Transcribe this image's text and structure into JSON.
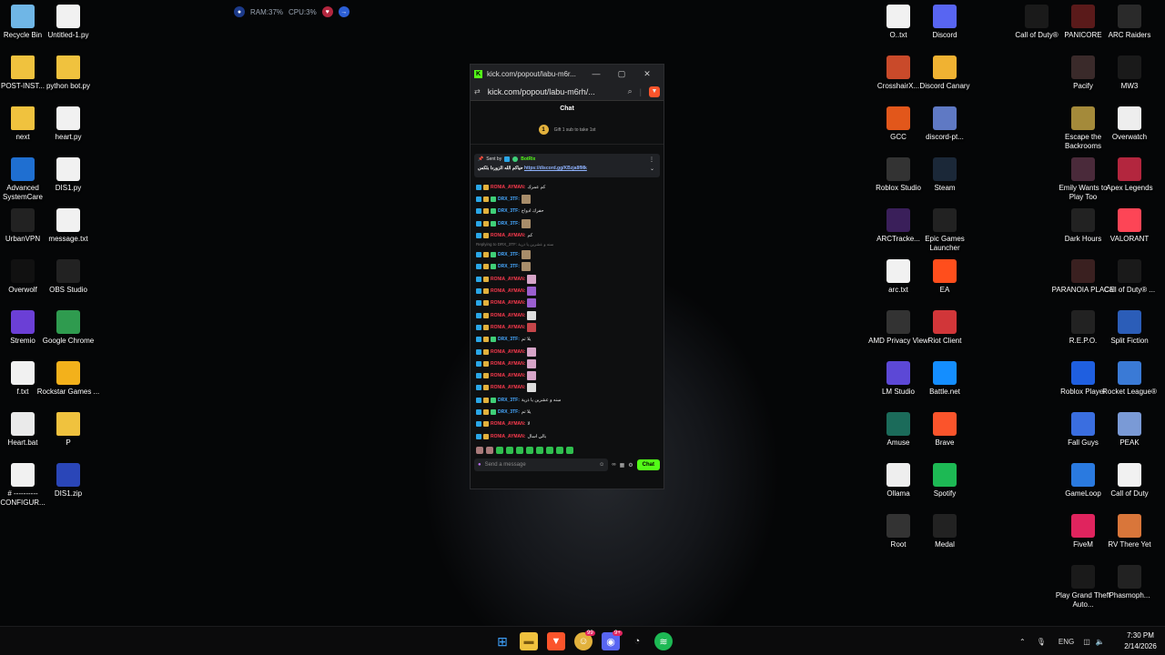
{
  "overlay": {
    "ram": "RAM:37%",
    "cpu": "CPU:3%"
  },
  "desktop": {
    "left": [
      {
        "label": "Recycle Bin",
        "icon": "recycle-bin-icon"
      },
      {
        "label": "Untitled-1.py",
        "icon": "python-file-icon"
      },
      {
        "label": "POST-INST...",
        "icon": "folder-icon"
      },
      {
        "label": "python bot.py",
        "icon": "folder-icon"
      },
      {
        "label": "next",
        "icon": "folder-icon"
      },
      {
        "label": "heart.py",
        "icon": "python-file-icon"
      },
      {
        "label": "Advanced SystemCare",
        "icon": "advanced-systemcare-icon"
      },
      {
        "label": "DIS1.py",
        "icon": "python-file-icon"
      },
      {
        "label": "UrbanVPN",
        "icon": "urbanvpn-icon"
      },
      {
        "label": "message.txt",
        "icon": "text-file-icon"
      },
      {
        "label": "Overwolf",
        "icon": "overwolf-icon"
      },
      {
        "label": "OBS Studio",
        "icon": "obs-icon"
      },
      {
        "label": "Stremio",
        "icon": "stremio-icon"
      },
      {
        "label": "Google Chrome",
        "icon": "chrome-icon"
      },
      {
        "label": "f.txt",
        "icon": "text-file-icon"
      },
      {
        "label": "Rockstar Games ...",
        "icon": "rockstar-icon"
      },
      {
        "label": "Heart.bat",
        "icon": "batch-file-icon"
      },
      {
        "label": "P",
        "icon": "folder-icon"
      },
      {
        "label": "# ---------- CONFIGUR...",
        "icon": "python-file-icon"
      },
      {
        "label": "DIS1.zip",
        "icon": "zip-file-icon"
      }
    ],
    "mid": [
      {
        "label": "O..txt",
        "icon": "text-file-icon"
      },
      {
        "label": "Discord",
        "icon": "discord-icon"
      },
      {
        "label": "CrosshairX...",
        "icon": "crosshairx-icon"
      },
      {
        "label": "Discord Canary",
        "icon": "discord-canary-icon"
      },
      {
        "label": "GCC",
        "icon": "gcc-icon"
      },
      {
        "label": "discord-pt...",
        "icon": "discord-ptb-icon"
      },
      {
        "label": "Roblox Studio",
        "icon": "roblox-studio-icon"
      },
      {
        "label": "Steam",
        "icon": "steam-icon"
      },
      {
        "label": "ARCTracke...",
        "icon": "arctracker-icon"
      },
      {
        "label": "Epic Games Launcher",
        "icon": "epic-games-icon"
      },
      {
        "label": "arc.txt",
        "icon": "text-file-icon"
      },
      {
        "label": "EA",
        "icon": "ea-icon"
      },
      {
        "label": "AMD Privacy View",
        "icon": "amd-icon"
      },
      {
        "label": "Riot Client",
        "icon": "riot-icon"
      },
      {
        "label": "LM Studio",
        "icon": "lm-studio-icon"
      },
      {
        "label": "Battle.net",
        "icon": "battlenet-icon"
      },
      {
        "label": "Amuse",
        "icon": "amuse-icon"
      },
      {
        "label": "Brave",
        "icon": "brave-icon"
      },
      {
        "label": "Ollama",
        "icon": "ollama-icon"
      },
      {
        "label": "Spotify",
        "icon": "spotify-icon"
      },
      {
        "label": "Root",
        "icon": "root-icon"
      },
      {
        "label": "Medal",
        "icon": "medal-icon"
      }
    ],
    "right": [
      {
        "label": "Call of Duty®",
        "icon": "cod-icon"
      },
      {
        "label": "PANICORE",
        "icon": "panicore-icon"
      },
      {
        "label": "ARC Raiders",
        "icon": "arc-raiders-icon"
      },
      {
        "label": "Pacify",
        "icon": "pacify-icon"
      },
      {
        "label": "MW3",
        "icon": "mw3-icon"
      },
      {
        "label": "Escape the Backrooms",
        "icon": "backrooms-icon"
      },
      {
        "label": "Overwatch",
        "icon": "overwatch-icon"
      },
      {
        "label": "Emily Wants to Play Too",
        "icon": "emily-icon"
      },
      {
        "label": "Apex Legends",
        "icon": "apex-icon"
      },
      {
        "label": "Dark Hours",
        "icon": "dark-hours-icon"
      },
      {
        "label": "VALORANT",
        "icon": "valorant-icon"
      },
      {
        "label": "PARANOIA PLACE",
        "icon": "paranoia-icon"
      },
      {
        "label": "Call of Duty® ...",
        "icon": "cod-icon"
      },
      {
        "label": "R.E.P.O.",
        "icon": "repo-icon"
      },
      {
        "label": "Split Fiction",
        "icon": "split-fiction-icon"
      },
      {
        "label": "Roblox Player",
        "icon": "roblox-icon"
      },
      {
        "label": "Rocket League®",
        "icon": "rocket-league-icon"
      },
      {
        "label": "Fall Guys",
        "icon": "fall-guys-icon"
      },
      {
        "label": "PEAK",
        "icon": "peak-icon"
      },
      {
        "label": "GameLoop",
        "icon": "gameloop-icon"
      },
      {
        "label": "Call of Duty",
        "icon": "text-file-icon"
      },
      {
        "label": "FiveM",
        "icon": "fivem-icon"
      },
      {
        "label": "RV There Yet",
        "icon": "rv-there-yet-icon"
      },
      {
        "label": "Play Grand Theft Auto...",
        "icon": "gta-icon"
      },
      {
        "label": "Phasmoph...",
        "icon": "phasmophobia-icon"
      }
    ]
  },
  "browser": {
    "tab_title": "kick.com/popout/labu-m6r...",
    "url": "kick.com/popout/labu-m6rh/...",
    "chat_header": "Chat",
    "gift_text": "Gift 1 sub to take 1st",
    "pinned": {
      "sent_by": "Sent by",
      "sender": "BotRix",
      "text": "حياكم الله الزوردا بلكس",
      "link": "https://discord.gg/KBzja8fMk"
    },
    "reply_text": "Replying to DRX_3TF: سنه و عشرين يا ذرية",
    "messages": [
      {
        "user": "RONIA_AYMAN",
        "color": "red",
        "text": "كم عمرك",
        "emote": ""
      },
      {
        "user": "DRX_3TF",
        "color": "cyan",
        "text": "",
        "emote": "e"
      },
      {
        "user": "DRX_3TF",
        "color": "cyan",
        "text": "حفرك ادواح",
        "emote": ""
      },
      {
        "user": "DRX_3TF",
        "color": "cyan",
        "text": "",
        "emote": "e"
      },
      {
        "user": "RONIA_AYMAN",
        "color": "red",
        "text": "كم",
        "emote": ""
      },
      {
        "user": "DRX_3TF",
        "color": "cyan",
        "text": "",
        "emote": "e"
      },
      {
        "user": "DRX_3TF",
        "color": "cyan",
        "text": "",
        "emote": "e"
      },
      {
        "user": "RONIA_AYMAN",
        "color": "red",
        "text": "",
        "emote": "e-k"
      },
      {
        "user": "RONIA_AYMAN",
        "color": "red",
        "text": "",
        "emote": "e-p"
      },
      {
        "user": "RONIA_AYMAN",
        "color": "red",
        "text": "",
        "emote": "e-p"
      },
      {
        "user": "RONIA_AYMAN",
        "color": "red",
        "text": "",
        "emote": "e-w"
      },
      {
        "user": "RONIA_AYMAN",
        "color": "red",
        "text": "",
        "emote": "e-r"
      },
      {
        "user": "DRX_3TF",
        "color": "cyan",
        "text": "يلا تم",
        "emote": ""
      },
      {
        "user": "RONIA_AYMAN",
        "color": "red",
        "text": "",
        "emote": "e-k"
      },
      {
        "user": "RONIA_AYMAN",
        "color": "red",
        "text": "",
        "emote": "e-k"
      },
      {
        "user": "RONIA_AYMAN",
        "color": "red",
        "text": "",
        "emote": "e-k"
      },
      {
        "user": "RONIA_AYMAN",
        "color": "red",
        "text": "",
        "emote": "e-w"
      },
      {
        "user": "DRX_3TF",
        "color": "cyan",
        "text": "سنه و عشرين يا ذرية",
        "emote": ""
      },
      {
        "user": "DRX_3TF",
        "color": "cyan",
        "text": "يلا تم",
        "emote": ""
      },
      {
        "user": "RONIA_AYMAN",
        "color": "red",
        "text": "لا",
        "emote": ""
      },
      {
        "user": "RONIA_AYMAN",
        "color": "red",
        "text": "بالي اسال",
        "emote": ""
      }
    ],
    "input_placeholder": "Send a message",
    "counter": "∞",
    "send_button": "Chat"
  },
  "taskbar": {
    "apps": [
      "windows-start-icon",
      "file-explorer-icon",
      "brave-icon",
      "emoji-app-icon",
      "discord-icon",
      "stopwatch-icon",
      "spotify-icon"
    ],
    "badge_emoji": "99",
    "badge_discord": "9+",
    "lang": "ENG",
    "time": "7:30 PM",
    "date": "2/14/2026"
  }
}
